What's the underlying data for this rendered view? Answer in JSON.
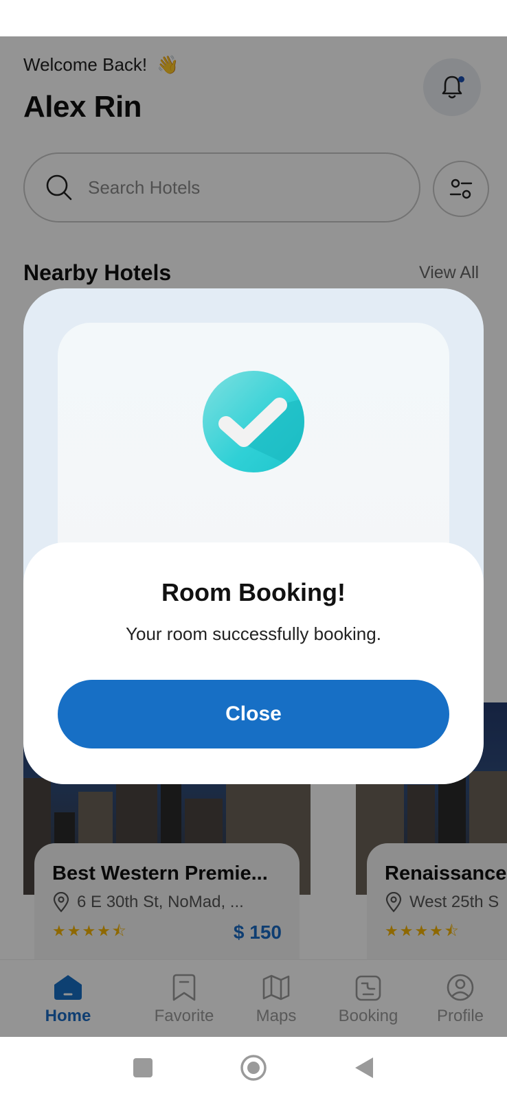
{
  "header": {
    "welcome_text": "Welcome Back!",
    "wave_emoji": "👋",
    "user_name": "Alex Rin"
  },
  "search": {
    "placeholder": "Search Hotels"
  },
  "nearby": {
    "title": "Nearby Hotels",
    "view_all": "View All"
  },
  "hotels": [
    {
      "name": "Best Western Premie...",
      "address": "6 E 30th St, NoMad, ...",
      "rating_stars": "★★★★⯪",
      "price": "$ 150"
    },
    {
      "name": "Renaissance",
      "address": "West 25th S",
      "rating_stars": "★★★★⯪"
    }
  ],
  "modal": {
    "title": "Room Booking!",
    "message": "Your room successfully booking.",
    "close_label": "Close",
    "icon": "check-circle-icon"
  },
  "bottom_nav": [
    {
      "label": "Home",
      "icon": "home-icon",
      "active": true
    },
    {
      "label": "Favorite",
      "icon": "bookmark-icon",
      "active": false
    },
    {
      "label": "Maps",
      "icon": "map-icon",
      "active": false
    },
    {
      "label": "Booking",
      "icon": "booking-icon",
      "active": false
    },
    {
      "label": "Profile",
      "icon": "profile-icon",
      "active": false
    }
  ],
  "colors": {
    "accent": "#176fc5",
    "check_gradient_start": "#7ee0e0",
    "check_gradient_end": "#1fc5cc",
    "star": "#f4b400"
  }
}
